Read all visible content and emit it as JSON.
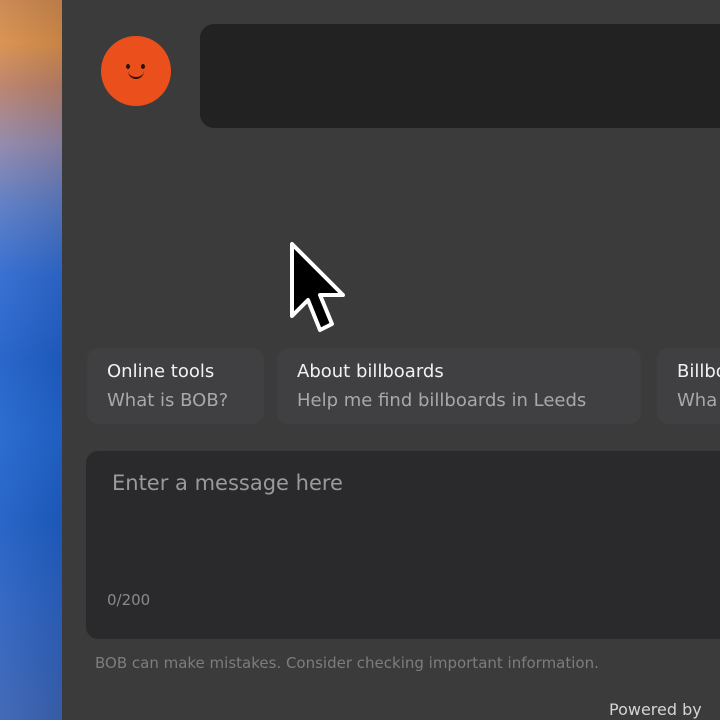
{
  "suggestions": [
    {
      "title": "Online tools",
      "subtitle": "What is BOB?"
    },
    {
      "title": "About billboards",
      "subtitle": "Help me find billboards in Leeds"
    },
    {
      "title": "Billbo",
      "subtitle": "Wha"
    }
  ],
  "composer": {
    "placeholder": "Enter a message here",
    "char_count": "0/200"
  },
  "footer": {
    "disclaimer": "BOB can make mistakes. Consider checking important information.",
    "powered_by": "Powered by"
  },
  "colors": {
    "panel_background": "#3b3b3c",
    "bubble_background": "#222223",
    "avatar": "#ea4f1c",
    "composer_background": "#2a2a2c"
  },
  "icons": {
    "avatar": "smiley-face",
    "cursor": "mouse-pointer-icon"
  }
}
